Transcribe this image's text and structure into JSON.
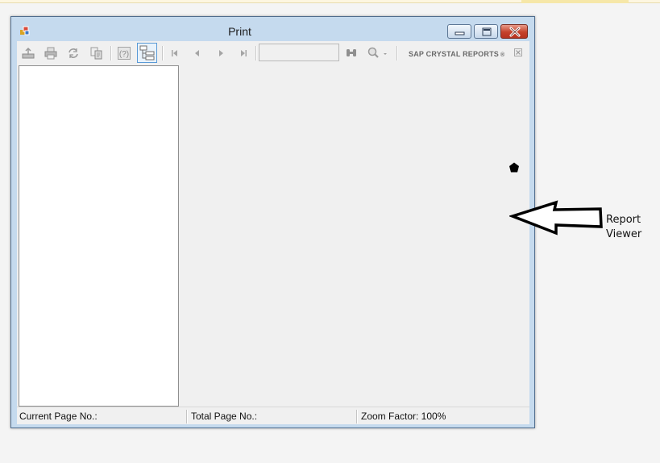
{
  "window": {
    "title": "Print",
    "caption_buttons": {
      "minimize": "minimize-icon",
      "maximize": "maximize-icon",
      "close": "close-icon"
    }
  },
  "toolbar": {
    "buttons": [
      {
        "icon": "export-icon"
      },
      {
        "icon": "print-icon"
      },
      {
        "icon": "refresh-icon"
      },
      {
        "icon": "copy-icon"
      },
      {
        "icon": "help-icon"
      },
      {
        "icon": "group-tree-toggle-icon",
        "pressed": true
      },
      {
        "icon": "first-page-icon"
      },
      {
        "icon": "previous-page-icon"
      },
      {
        "icon": "next-page-icon"
      },
      {
        "icon": "last-page-icon"
      },
      {
        "icon": "find-icon"
      },
      {
        "icon": "zoom-icon"
      }
    ],
    "goto_page_value": "",
    "brand": "SAP CRYSTAL REPORTS",
    "brand_mark": "®"
  },
  "status_bar": {
    "current_page": "Current Page No.:",
    "total_page": "Total Page No.:",
    "zoom_factor": "Zoom Factor: 100%"
  },
  "annotation": {
    "line1": "Report",
    "line2": "Viewer"
  },
  "colors": {
    "titlebar": "#c5daee",
    "close_button": "#c5422b",
    "toolbar_bg": "#f0f0f0"
  }
}
